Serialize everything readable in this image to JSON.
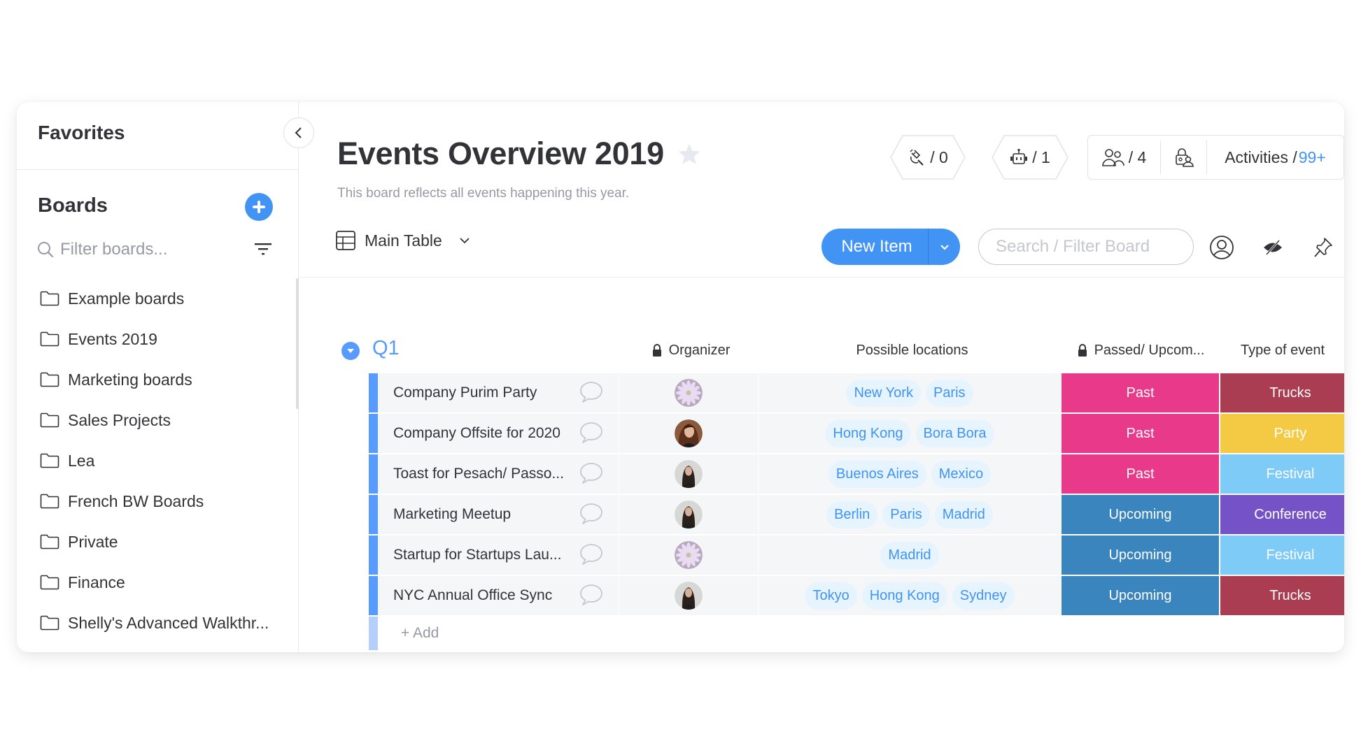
{
  "sidebar": {
    "favorites_title": "Favorites",
    "boards_title": "Boards",
    "filter_placeholder": "Filter boards...",
    "items": [
      {
        "label": "Example boards"
      },
      {
        "label": "Events 2019"
      },
      {
        "label": "Marketing boards"
      },
      {
        "label": "Sales Projects"
      },
      {
        "label": "Lea"
      },
      {
        "label": "French BW Boards"
      },
      {
        "label": "Private"
      },
      {
        "label": "Finance"
      },
      {
        "label": "Shelly's Advanced Walkthr..."
      }
    ]
  },
  "header": {
    "title": "Events Overview 2019",
    "description": "This board reflects all events happening this year.",
    "integrations_count": "/ 0",
    "automations_count": "/ 1",
    "members_count": "/ 4",
    "activities_label": "Activities /",
    "activities_count": "99+",
    "view_label": "Main Table",
    "new_item_label": "New Item",
    "search_placeholder": "Search / Filter Board"
  },
  "colors": {
    "accent": "#4193f4",
    "group": "#579bfc",
    "status_past": "#e8398a",
    "status_upcoming": "#3a85bd",
    "type_trucks": "#ab3d53",
    "type_party": "#f4c944",
    "type_festival": "#7ecbf8",
    "type_conference": "#7553c6"
  },
  "table": {
    "group_title": "Q1",
    "columns": {
      "organizer": "Organizer",
      "locations": "Possible locations",
      "status": "Passed/ Upcom...",
      "type": "Type of event"
    },
    "rows": [
      {
        "name": "Company Purim Party",
        "avatar": "flower",
        "locations": [
          "New York",
          "Paris"
        ],
        "status": "Past",
        "type": "Trucks"
      },
      {
        "name": "Company Offsite for 2020",
        "avatar": "woman-hair",
        "locations": [
          "Hong Kong",
          "Bora Bora"
        ],
        "status": "Past",
        "type": "Party"
      },
      {
        "name": "Toast for Pesach/ Passo...",
        "avatar": "woman-dark",
        "locations": [
          "Buenos Aires",
          "Mexico"
        ],
        "status": "Past",
        "type": "Festival"
      },
      {
        "name": "Marketing Meetup",
        "avatar": "woman-dark",
        "locations": [
          "Berlin",
          "Paris",
          "Madrid"
        ],
        "status": "Upcoming",
        "type": "Conference"
      },
      {
        "name": "Startup for Startups Lau...",
        "avatar": "flower",
        "locations": [
          "Madrid"
        ],
        "status": "Upcoming",
        "type": "Festival"
      },
      {
        "name": "NYC Annual Office Sync",
        "avatar": "woman-dark",
        "locations": [
          "Tokyo",
          "Hong Kong",
          "Sydney"
        ],
        "status": "Upcoming",
        "type": "Trucks"
      }
    ],
    "add_label": "+ Add"
  }
}
